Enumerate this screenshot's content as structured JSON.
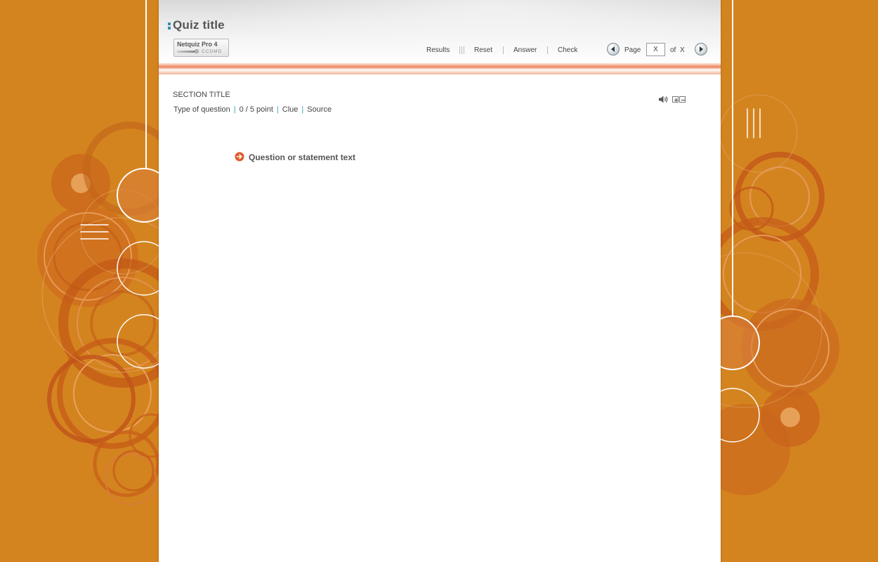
{
  "header": {
    "quiz_title": "Quiz title",
    "logo_name": "Netquiz Pro 4",
    "logo_sub": "CCDMD"
  },
  "toolbar": {
    "results_label": "Results",
    "reset_label": "Reset",
    "answer_label": "Answer",
    "check_label": "Check"
  },
  "pagination": {
    "page_label": "Page",
    "page_value": "X",
    "of_label": "of",
    "total": "X"
  },
  "section": {
    "title": "SECTION TITLE",
    "question_type": "Type of question",
    "score": "0 / 5 point",
    "clue_label": "Clue",
    "source_label": "Source"
  },
  "question": {
    "text": "Question or statement text"
  },
  "icons": {
    "speaker": "speaker-icon",
    "zoom_in": "zoom-in-icon",
    "zoom_out": "zoom-out-icon",
    "prev": "previous-page-icon",
    "next": "next-page-icon",
    "bullet": "arrow-bullet-icon"
  },
  "colors": {
    "background": "#d4841f",
    "accent_orange": "#e05a2a",
    "accent_blue": "#3aa0c0",
    "panel": "#ffffff"
  }
}
